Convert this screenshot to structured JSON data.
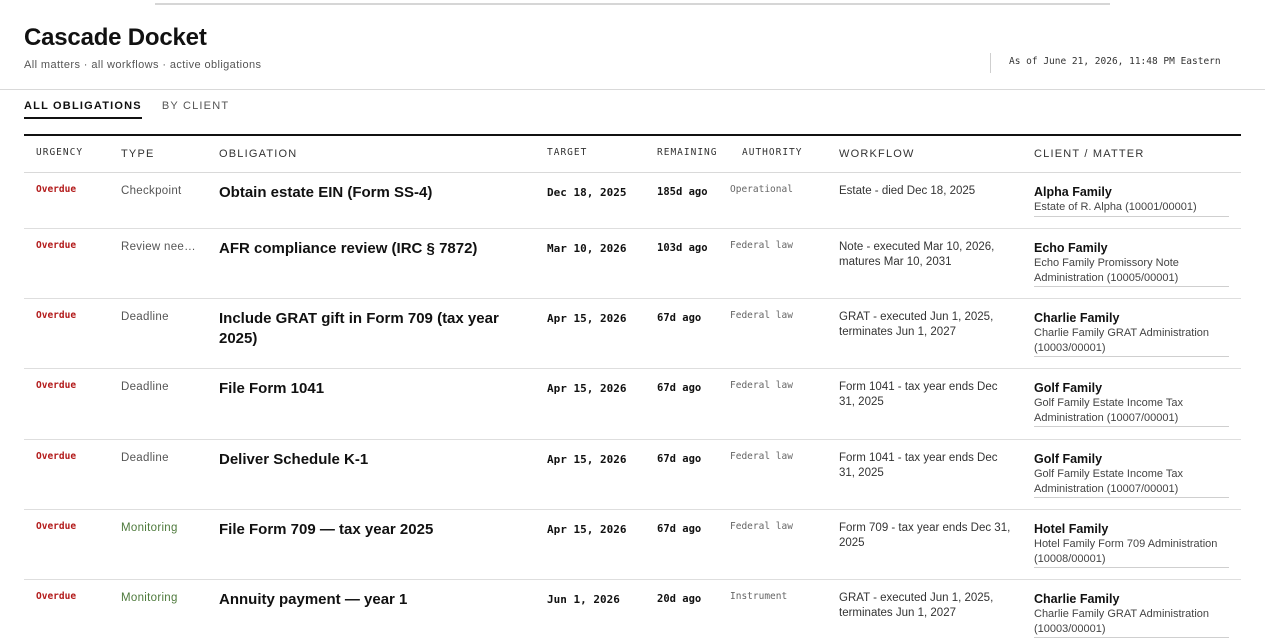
{
  "app": {
    "title": "Cascade Docket",
    "subtitle": "All matters · all workflows · active obligations",
    "as_of": "As of June 21, 2026, 11:48 PM Eastern"
  },
  "tabs": [
    {
      "label": "ALL OBLIGATIONS",
      "active": true
    },
    {
      "label": "BY CLIENT",
      "active": false
    }
  ],
  "columns": {
    "urgency": "URGENCY",
    "type": "TYPE",
    "obligation": "OBLIGATION",
    "target": "TARGET",
    "remaining": "REMAINING",
    "authority": "AUTHORITY",
    "workflow": "WORKFLOW",
    "client": "CLIENT / MATTER"
  },
  "colors": {
    "overdue": "#b31b1b",
    "monitoring": "#4e7a3c",
    "rule": "#111111"
  },
  "rows": [
    {
      "urgency": "Overdue",
      "type": "Checkpoint",
      "obligation": "Obtain estate EIN (Form SS-4)",
      "target": "Dec 18, 2025",
      "remaining": "185d ago",
      "authority": "Operational",
      "workflow": "Estate - died Dec 18, 2025",
      "client": "Alpha Family",
      "matter": "Estate of R. Alpha (10001/00001)"
    },
    {
      "urgency": "Overdue",
      "type": "Review nee…",
      "obligation": "AFR compliance review (IRC § 7872)",
      "target": "Mar 10, 2026",
      "remaining": "103d ago",
      "authority": "Federal law",
      "workflow": "Note - executed Mar 10, 2026, matures Mar 10, 2031",
      "client": "Echo Family",
      "matter": "Echo Family Promissory Note Administration (10005/00001)"
    },
    {
      "urgency": "Overdue",
      "type": "Deadline",
      "obligation": "Include GRAT gift in Form 709 (tax year 2025)",
      "target": "Apr 15, 2026",
      "remaining": "67d ago",
      "authority": "Federal law",
      "workflow": "GRAT - executed Jun 1, 2025, terminates Jun 1, 2027",
      "client": "Charlie Family",
      "matter": "Charlie Family GRAT Administration (10003/00001)"
    },
    {
      "urgency": "Overdue",
      "type": "Deadline",
      "obligation": "File Form 1041",
      "target": "Apr 15, 2026",
      "remaining": "67d ago",
      "authority": "Federal law",
      "workflow": "Form 1041 - tax year ends Dec 31, 2025",
      "client": "Golf Family",
      "matter": "Golf Family Estate Income Tax Administration (10007/00001)"
    },
    {
      "urgency": "Overdue",
      "type": "Deadline",
      "obligation": "Deliver Schedule K-1",
      "target": "Apr 15, 2026",
      "remaining": "67d ago",
      "authority": "Federal law",
      "workflow": "Form 1041 - tax year ends Dec 31, 2025",
      "client": "Golf Family",
      "matter": "Golf Family Estate Income Tax Administration (10007/00001)"
    },
    {
      "urgency": "Overdue",
      "type": "Monitoring",
      "obligation": "File Form 709 — tax year 2025",
      "target": "Apr 15, 2026",
      "remaining": "67d ago",
      "authority": "Federal law",
      "workflow": "Form 709 - tax year ends Dec 31, 2025",
      "client": "Hotel Family",
      "matter": "Hotel Family Form 709 Administration (10008/00001)"
    },
    {
      "urgency": "Overdue",
      "type": "Monitoring",
      "obligation": "Annuity payment — year 1",
      "target": "Jun 1, 2026",
      "remaining": "20d ago",
      "authority": "Instrument",
      "workflow": "GRAT - executed Jun 1, 2025, terminates Jun 1, 2027",
      "client": "Charlie Family",
      "matter": "Charlie Family GRAT Administration (10003/00001)"
    }
  ]
}
